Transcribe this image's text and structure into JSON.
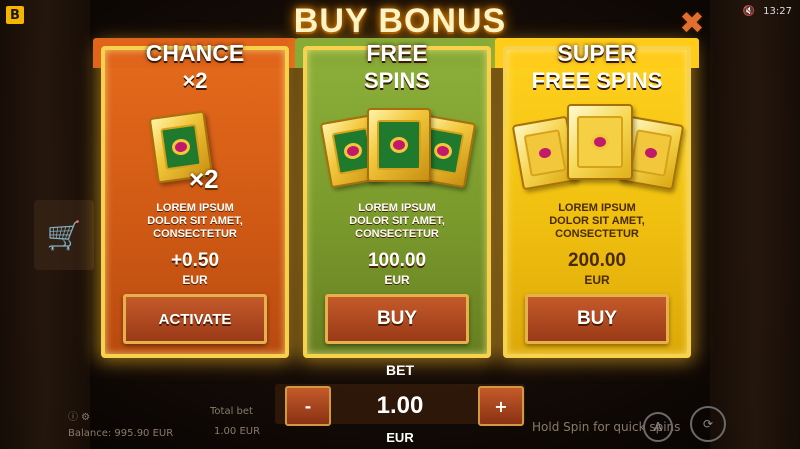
{
  "header": {
    "title": "BUY BONUS",
    "logo": "B",
    "time": "13:27",
    "status_icon": "volume-mute-icon",
    "close_icon": "close-icon"
  },
  "cards": [
    {
      "title": "CHANCE",
      "subtitle": "×2",
      "multiplier": "×2",
      "desc": [
        "LOREM IPSUM",
        "DOLOR SIT AMET,",
        "CONSECTETUR"
      ],
      "price": "+0.50",
      "currency": "EUR",
      "button": "ACTIVATE",
      "color": "#e56a1c"
    },
    {
      "title": "FREE",
      "subtitle": "SPINS",
      "desc": [
        "LOREM IPSUM",
        "DOLOR SIT AMET,",
        "CONSECTETUR"
      ],
      "price": "100.00",
      "currency": "EUR",
      "button": "BUY",
      "color": "#8db03a"
    },
    {
      "title": "SUPER",
      "subtitle": "FREE SPINS",
      "desc": [
        "LOREM IPSUM",
        "DOLOR SIT AMET,",
        "CONSECTETUR"
      ],
      "price": "200.00",
      "currency": "EUR",
      "button": "BUY",
      "color": "#ffd21e"
    }
  ],
  "bet": {
    "label": "BET",
    "value": "1.00",
    "currency": "EUR",
    "minus": "-",
    "plus": "+"
  },
  "background": {
    "balance": "Balance: 995.90 EUR",
    "total_bet_label": "Total bet",
    "total_bet_value": "1.00 EUR",
    "hint": "Hold Spin for quick spins"
  }
}
